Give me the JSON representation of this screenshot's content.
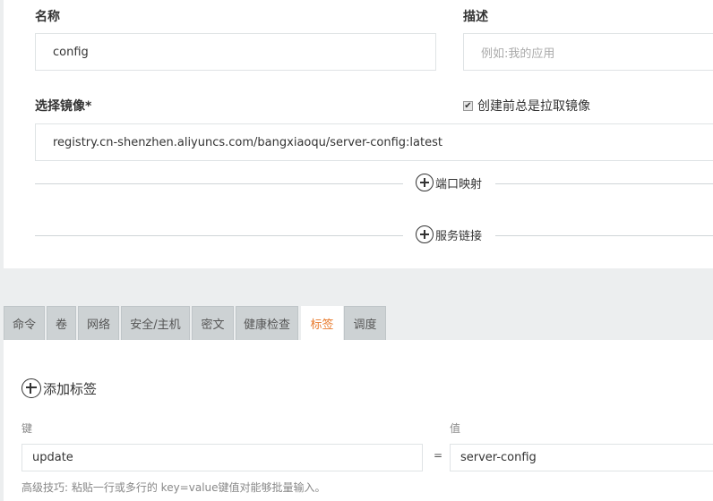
{
  "form": {
    "name_label": "名称",
    "name_value": "config",
    "desc_label": "描述",
    "desc_placeholder": "例如:我的应用",
    "image_label": "选择镜像*",
    "always_pull_label": "创建前总是拉取镜像",
    "always_pull_checked": true,
    "image_value": "registry.cn-shenzhen.aliyuncs.com/bangxiaoqu/server-config:latest",
    "port_mapping_label": "端口映射",
    "service_link_label": "服务链接"
  },
  "tabs": [
    {
      "label": "命令"
    },
    {
      "label": "卷"
    },
    {
      "label": "网络"
    },
    {
      "label": "安全/主机"
    },
    {
      "label": "密文"
    },
    {
      "label": "健康检查"
    },
    {
      "label": "标签",
      "active": true
    },
    {
      "label": "调度"
    }
  ],
  "labels_tab": {
    "add_label": "添加标签",
    "key_header": "键",
    "value_header": "值",
    "key_value": "update",
    "equals": "=",
    "value_value": "server-config",
    "hint": "高级技巧: 粘贴一行或多行的 key=value键值对能够批量输入。"
  },
  "colors": {
    "accent": "#e8792b",
    "background": "#eceeef",
    "tab_bg": "#cdd2d4"
  }
}
